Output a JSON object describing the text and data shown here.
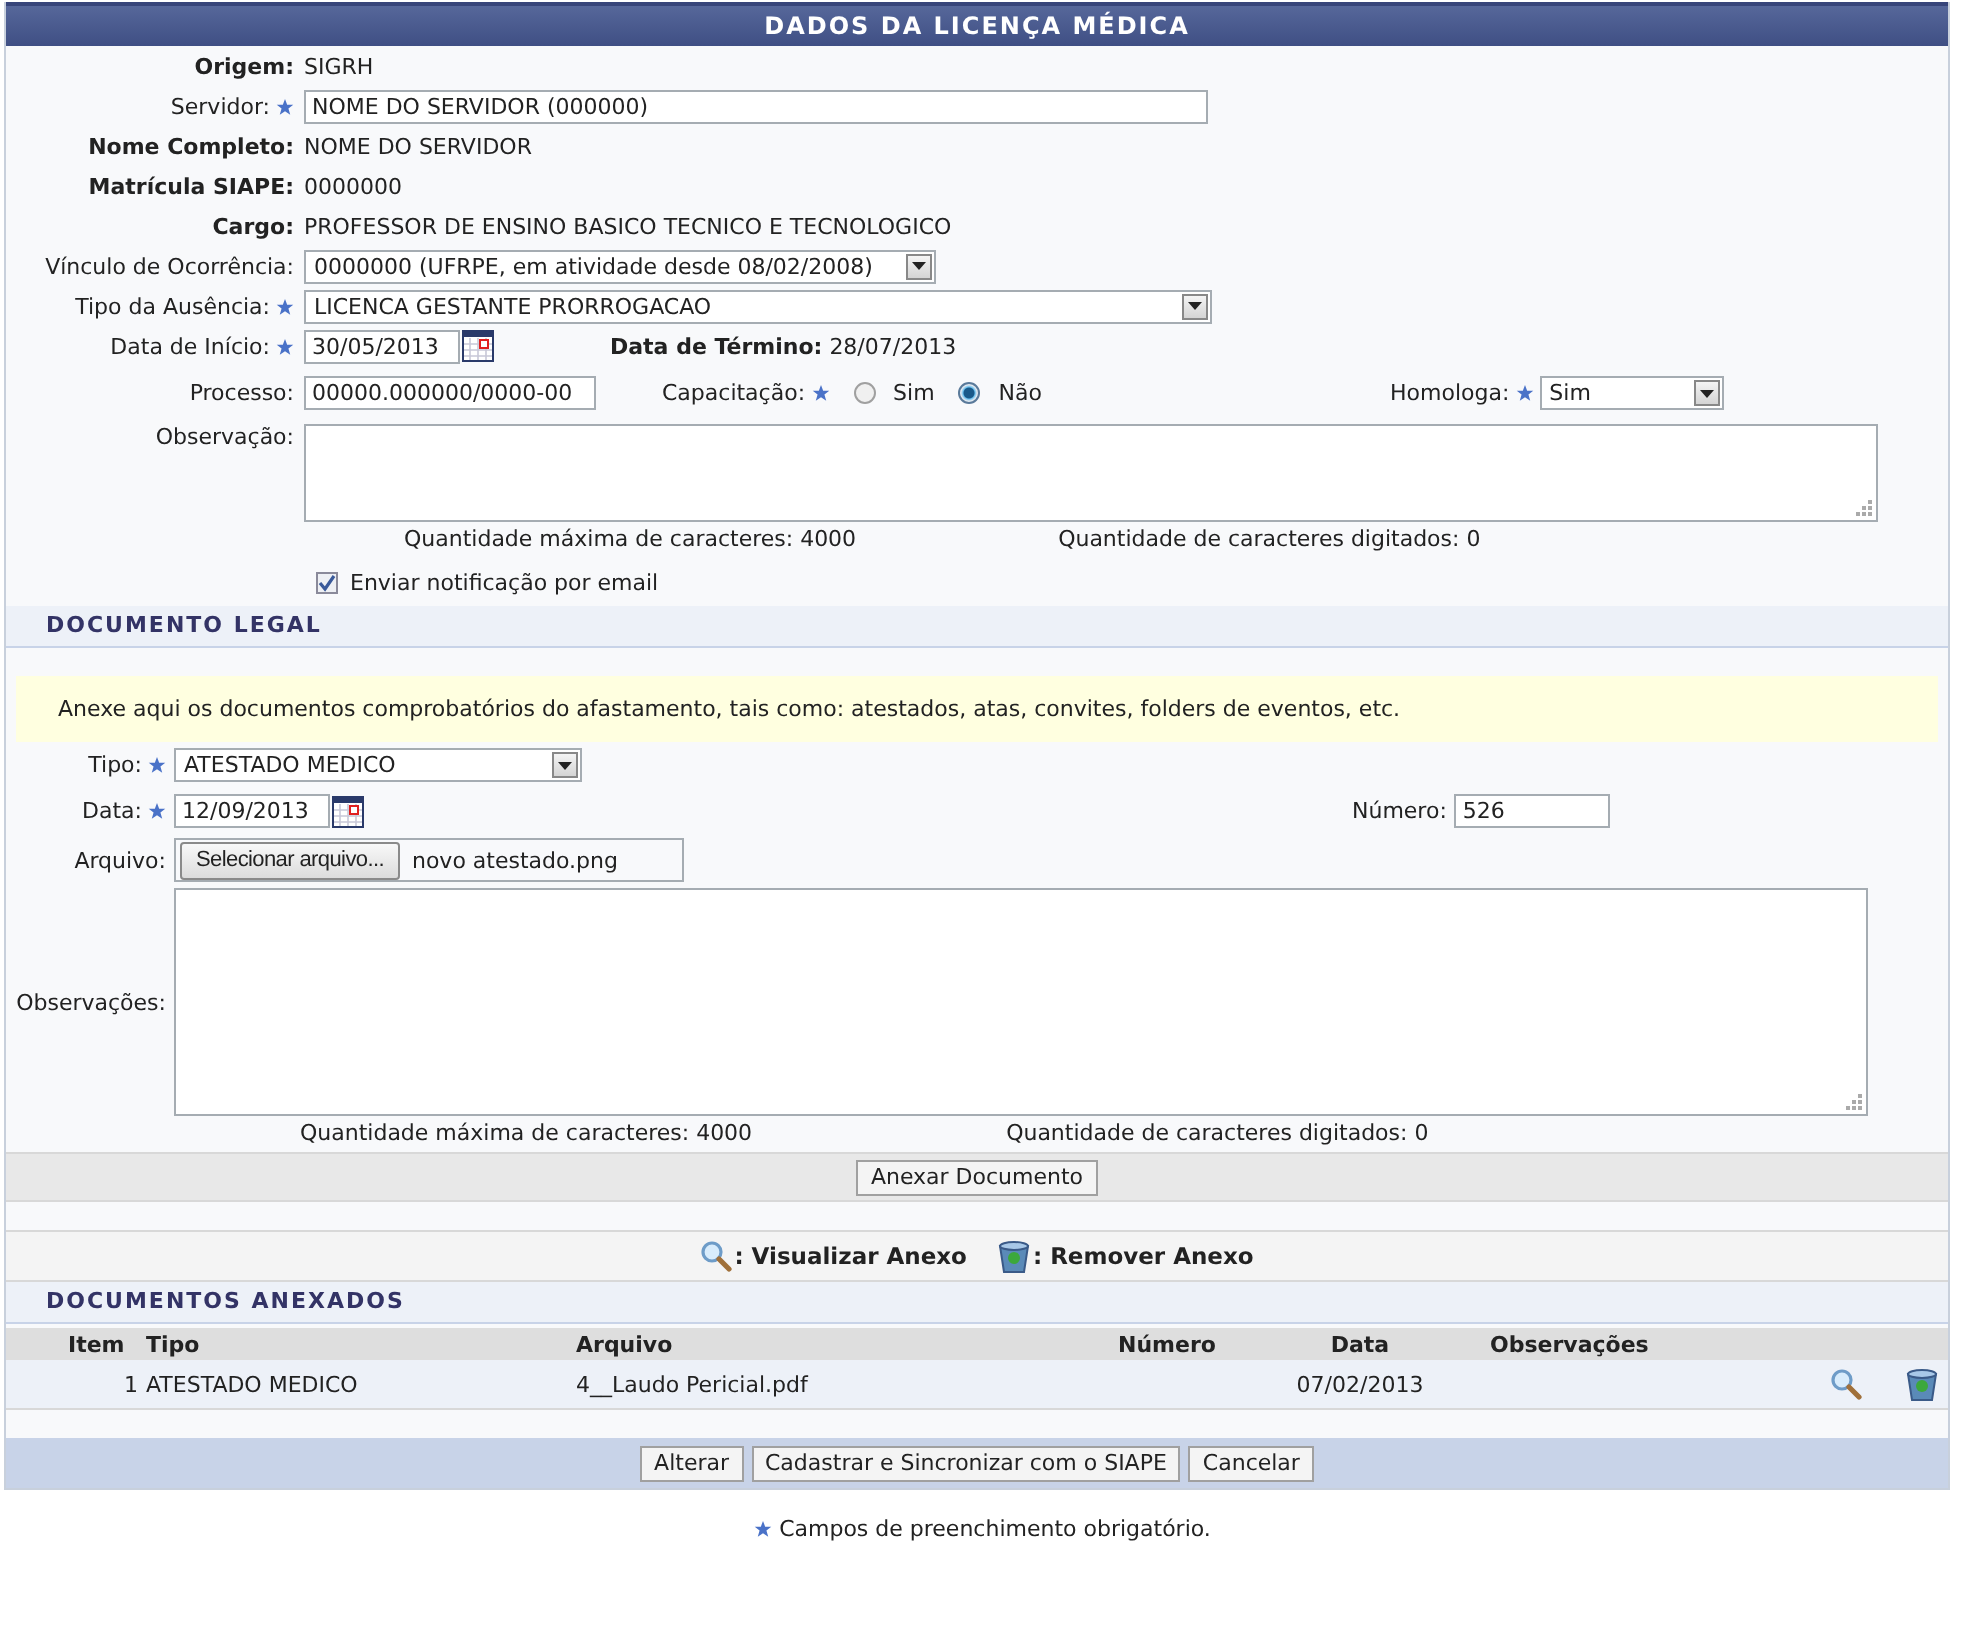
{
  "title": "DADOS DA LICENÇA MÉDICA",
  "dados": {
    "origem": {
      "label": "Origem:",
      "value": "SIGRH"
    },
    "servidor": {
      "label": "Servidor:",
      "required": true,
      "value": "NOME DO SERVIDOR (000000)"
    },
    "nome_completo": {
      "label": "Nome Completo:",
      "value": "NOME DO SERVIDOR"
    },
    "matricula": {
      "label": "Matrícula SIAPE:",
      "value": "0000000"
    },
    "cargo": {
      "label": "Cargo:",
      "value": "PROFESSOR DE ENSINO BASICO TECNICO E TECNOLOGICO"
    },
    "vinculo": {
      "label": "Vínculo de Ocorrência:",
      "value": "0000000 (UFRPE, em atividade desde 08/02/2008)"
    },
    "tipo_ausencia": {
      "label": "Tipo da Ausência:",
      "required": true,
      "value": "LICENCA GESTANTE PRORROGACAO"
    },
    "data_inicio": {
      "label": "Data de Início:",
      "required": true,
      "value": "30/05/2013"
    },
    "data_termino": {
      "label": "Data de Término:",
      "value": "28/07/2013"
    },
    "processo": {
      "label": "Processo:",
      "value": "00000.000000/0000-00"
    },
    "capacitacao": {
      "label": "Capacitação:",
      "required": true,
      "options": [
        {
          "label": "Sim",
          "selected": false
        },
        {
          "label": "Não",
          "selected": true
        }
      ]
    },
    "homologa": {
      "label": "Homologa:",
      "required": true,
      "value": "Sim"
    },
    "observacao": {
      "label": "Observação:"
    },
    "max_chars": "Quantidade máxima de caracteres: 4000",
    "typed_chars": "Quantidade de caracteres digitados: 0",
    "notify": {
      "label": "Enviar notificação por email",
      "checked": true
    }
  },
  "documento_legal": {
    "title": "DOCUMENTO LEGAL",
    "note": "Anexe aqui os documentos comprobatórios do afastamento, tais como: atestados, atas, convites, folders de eventos, etc.",
    "tipo": {
      "label": "Tipo:",
      "required": true,
      "value": "ATESTADO MEDICO"
    },
    "data": {
      "label": "Data:",
      "required": true,
      "value": "12/09/2013"
    },
    "numero": {
      "label": "Número:",
      "value": "526"
    },
    "arquivo": {
      "label": "Arquivo:",
      "button": "Selecionar arquivo...",
      "file": "novo atestado.png"
    },
    "observacoes": {
      "label": "Observações:"
    },
    "max_chars": "Quantidade máxima de caracteres: 4000",
    "typed_chars": "Quantidade de caracteres digitados: 0",
    "attach_button": "Anexar Documento"
  },
  "legend": [
    {
      "kind": "view",
      "label": ": Visualizar Anexo"
    },
    {
      "kind": "remove",
      "label": ": Remover Anexo"
    }
  ],
  "anexados": {
    "title": "DOCUMENTOS ANEXADOS",
    "columns": [
      "Item",
      "Tipo",
      "Arquivo",
      "Número",
      "Data",
      "Observações"
    ],
    "rows": [
      {
        "item": "1",
        "tipo": "ATESTADO MEDICO",
        "arquivo": "4__Laudo Pericial.pdf",
        "data": "07/02/2013"
      }
    ]
  },
  "buttons": [
    "Alterar",
    "Cadastrar e Sincronizar com o SIAPE",
    "Cancelar"
  ],
  "footer": "Campos de preenchimento obrigatório."
}
